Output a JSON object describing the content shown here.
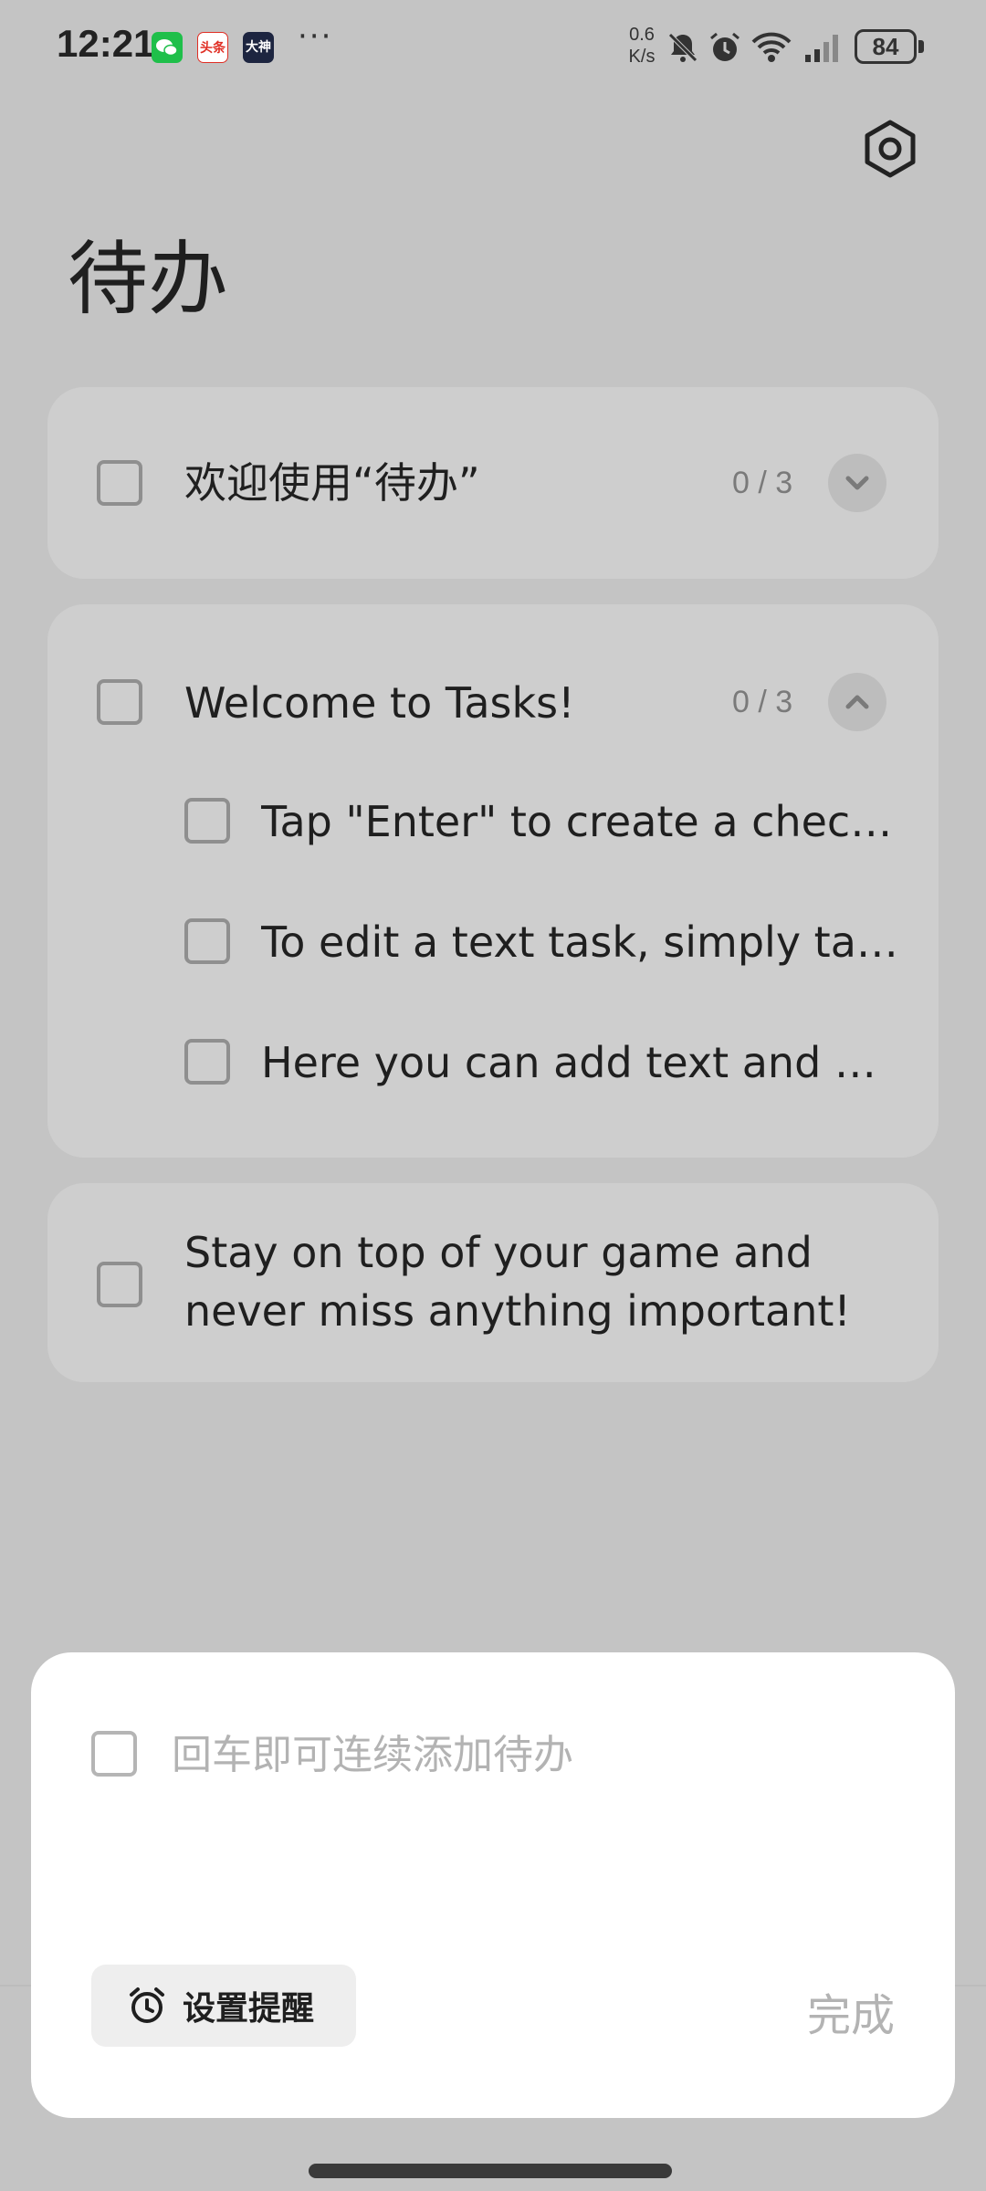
{
  "status_bar": {
    "time": "12:21",
    "apps": [
      {
        "name": "wechat-icon",
        "label": "",
        "color": "#1fbf4a"
      },
      {
        "name": "toutiao-icon",
        "label": "头条",
        "color": "#e02e24"
      },
      {
        "name": "dashen-icon",
        "label": "大神",
        "color": "#1d2540"
      }
    ],
    "more": "···",
    "net_speed_value": "0.6",
    "net_speed_unit": "K/s",
    "battery": "84"
  },
  "page": {
    "title": "待办"
  },
  "groups": [
    {
      "title": "欢迎使用“待办”",
      "count": "0 / 3",
      "expanded": false
    },
    {
      "title": "Welcome to Tasks!",
      "count": "0 / 3",
      "expanded": true,
      "subtasks": [
        "Tap \"Enter\" to create a checklist",
        "To edit a text task, simply tap it",
        "Here you can add text and voice tasks"
      ]
    }
  ],
  "standalone_task": {
    "line1": "Stay on top of your game and",
    "line2": "never miss anything important!"
  },
  "new_task_sheet": {
    "placeholder": "回车即可连续添加待办",
    "reminder_label": "设置提醒",
    "done_label": "完成"
  }
}
